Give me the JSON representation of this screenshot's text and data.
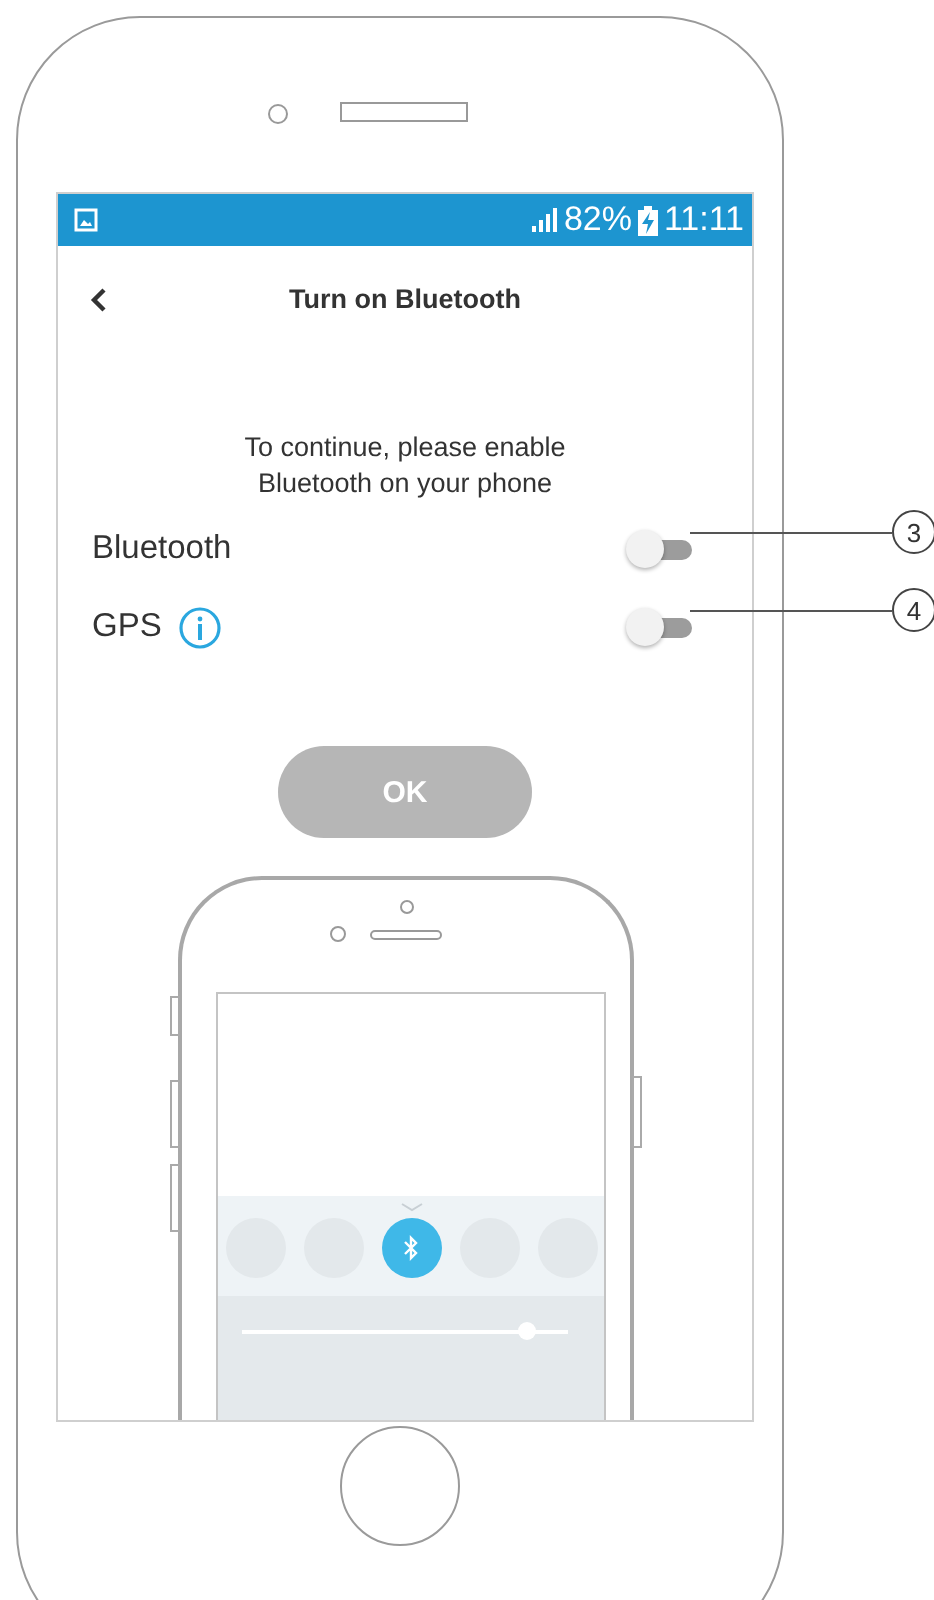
{
  "status_bar": {
    "battery": "82%",
    "time": "11:11"
  },
  "header": {
    "title": "Turn on Bluetooth"
  },
  "message": "To continue, please enable Bluetooth on your phone",
  "settings": [
    {
      "label": "Bluetooth",
      "info": false,
      "on": false,
      "callout": "3"
    },
    {
      "label": "GPS",
      "info": true,
      "on": false,
      "callout": "4"
    }
  ],
  "ok_button": {
    "label": "OK",
    "disabled": true
  },
  "illustration": {
    "tiles": [
      {
        "kind": "blank",
        "selected": false
      },
      {
        "kind": "blank",
        "selected": false
      },
      {
        "kind": "bluetooth",
        "selected": true
      },
      {
        "kind": "blank",
        "selected": false
      },
      {
        "kind": "blank",
        "selected": false
      }
    ],
    "brightness": {
      "level": 0.87
    }
  }
}
